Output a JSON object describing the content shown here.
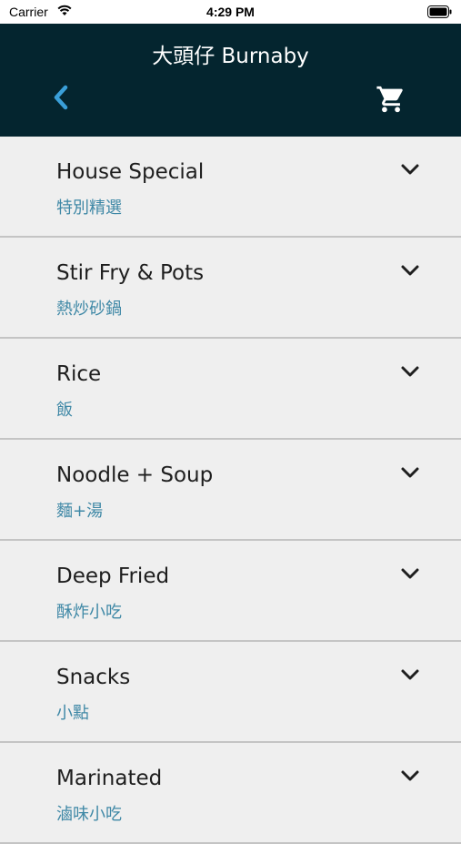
{
  "status_bar": {
    "carrier": "Carrier",
    "time": "4:29 PM"
  },
  "header": {
    "title": "大頭仔 Burnaby",
    "background_color": "#04252f",
    "back_icon": "chevron-left-icon",
    "cart_icon": "shopping-cart-icon",
    "accent_color": "#3a9fd8"
  },
  "categories": [
    {
      "name": "House Special",
      "subtitle": "特別精選"
    },
    {
      "name": "Stir Fry & Pots",
      "subtitle": "熱炒砂鍋"
    },
    {
      "name": "Rice",
      "subtitle": "飯"
    },
    {
      "name": "Noodle + Soup",
      "subtitle": "麵+湯"
    },
    {
      "name": "Deep Fried",
      "subtitle": "酥炸小吃"
    },
    {
      "name": "Snacks",
      "subtitle": "小點"
    },
    {
      "name": "Marinated",
      "subtitle": "滷味小吃"
    }
  ],
  "subtitle_color": "#3f88a6",
  "expand_icon": "chevron-down-icon"
}
